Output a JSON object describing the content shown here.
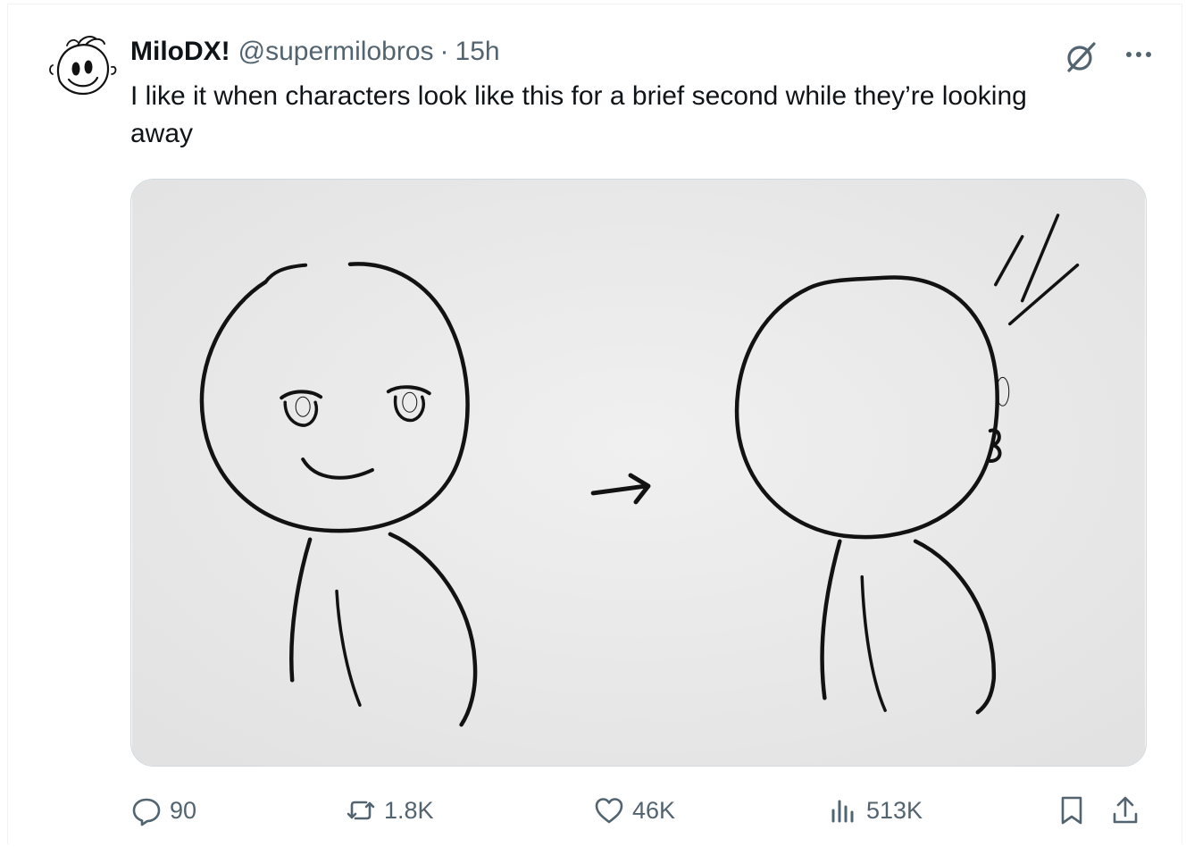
{
  "post": {
    "author_name": "MiloDX!",
    "handle": "@supermilobros",
    "separator": "·",
    "time": "15h",
    "text": "I like it when characters look like this for a brief second while they’re looking away"
  },
  "metrics": {
    "replies": "90",
    "reposts": "1.8K",
    "likes": "46K",
    "views": "513K"
  },
  "icons": {
    "grok": "grok-icon",
    "more": "more-horizontal-icon",
    "reply": "reply-icon",
    "repost": "repost-icon",
    "like": "heart-icon",
    "views": "analytics-icon",
    "bookmark": "bookmark-icon",
    "share": "share-icon"
  },
  "colors": {
    "text_primary": "#0f1419",
    "text_secondary": "#536471",
    "border": "#cfd9de",
    "paper": "#ebebeb"
  }
}
